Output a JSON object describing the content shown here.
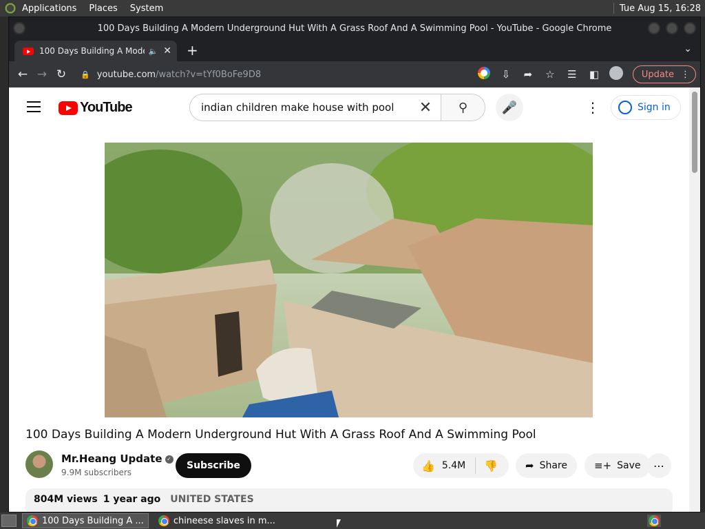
{
  "top_panel": {
    "menus": [
      "Applications",
      "Places",
      "System"
    ],
    "clock": "Tue Aug 15, 16:28"
  },
  "window": {
    "title": "100 Days Building A Modern Underground Hut With A Grass Roof And A Swimming Pool - YouTube - Google Chrome"
  },
  "tab": {
    "title": "100 Days Building A Modern Underground Hut With A Grass Roof And A Swimming Pool - YouTube"
  },
  "omnibox": {
    "host": "youtube.com",
    "path": "/watch?v=tYf0BoFe9D8"
  },
  "browser": {
    "update_label": "Update"
  },
  "youtube": {
    "logo_text": "YouTube",
    "search_query": "indian children make house with pool",
    "signin_label": "Sign in",
    "video_title": "100 Days Building A Modern Underground Hut With A Grass Roof And A Swimming Pool",
    "channel_name": "Mr.Heang Update",
    "subscribers": "9.9M subscribers",
    "subscribe_label": "Subscribe",
    "likes": "5.4M",
    "share_label": "Share",
    "save_label": "Save",
    "views": "804M views",
    "age": "1 year ago",
    "country": "UNITED STATES"
  },
  "taskbar": {
    "items": [
      "100 Days Building A ...",
      "chineese slaves in m..."
    ]
  },
  "colors": {
    "youtube_red": "#ff0000",
    "signin_blue": "#065fd4",
    "update_red": "#f28b82"
  }
}
